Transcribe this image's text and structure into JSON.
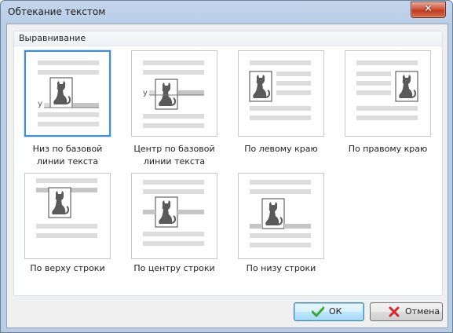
{
  "window": {
    "title": "Обтекание текстом"
  },
  "group": {
    "title": "Выравнивание"
  },
  "options": [
    {
      "label": "Низ по базовой\nлинии текста",
      "selected": true
    },
    {
      "label": "Центр по базовой\nлинии текста",
      "selected": false
    },
    {
      "label": "По левому краю",
      "selected": false
    },
    {
      "label": "По правому краю",
      "selected": false
    },
    {
      "label": "По верху строки",
      "selected": false
    },
    {
      "label": "По центру строки",
      "selected": false
    },
    {
      "label": "По низу строки",
      "selected": false
    }
  ],
  "preview_glyph": "y",
  "buttons": {
    "ok": "ОК",
    "cancel": "Отмена"
  },
  "colors": {
    "selection": "#3a8fde",
    "text_line": "#dcdcdc",
    "highlight_line": "#c6c6c6",
    "cat": "#5a5a5a",
    "ok_icon": "#3aa82e",
    "cancel_icon": "#d7262a"
  },
  "icons": {
    "close": "close-icon",
    "ok": "checkmark-icon",
    "cancel": "cross-icon"
  }
}
